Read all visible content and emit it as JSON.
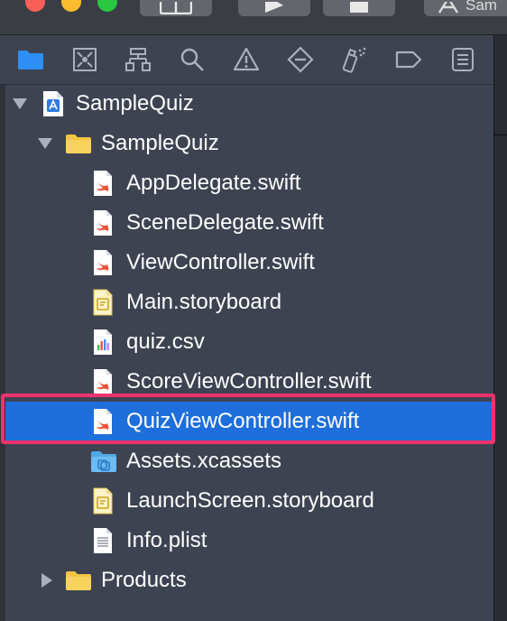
{
  "toolbar": {
    "scheme_label": "Sam"
  },
  "colors": {
    "navigator_bg": "#3e4352",
    "selection": "#1e6edc",
    "highlight_border": "#f0326d",
    "folder": "#f4c542",
    "swift": "#f05138"
  },
  "navigator_icons": [
    "folder-icon",
    "source-control-icon",
    "hierarchy-icon",
    "search-icon",
    "warning-icon",
    "test-diamond-icon",
    "debug-spray-icon",
    "breakpoint-tag-icon",
    "report-icon"
  ],
  "tree": {
    "project": {
      "label": "SampleQuiz",
      "icon": "xcode-project-icon"
    },
    "group": {
      "label": "SampleQuiz",
      "icon": "folder-icon"
    },
    "files": [
      {
        "label": "AppDelegate.swift",
        "icon": "swift-file-icon"
      },
      {
        "label": "SceneDelegate.swift",
        "icon": "swift-file-icon"
      },
      {
        "label": "ViewController.swift",
        "icon": "swift-file-icon"
      },
      {
        "label": "Main.storyboard",
        "icon": "storyboard-file-icon"
      },
      {
        "label": "quiz.csv",
        "icon": "csv-file-icon"
      },
      {
        "label": "ScoreViewController.swift",
        "icon": "swift-file-icon"
      },
      {
        "label": "QuizViewController.swift",
        "icon": "swift-file-icon",
        "selected": true
      },
      {
        "label": "Assets.xcassets",
        "icon": "asset-catalog-icon"
      },
      {
        "label": "LaunchScreen.storyboard",
        "icon": "storyboard-file-icon"
      },
      {
        "label": "Info.plist",
        "icon": "plist-file-icon"
      }
    ],
    "products": {
      "label": "Products",
      "icon": "folder-icon"
    }
  }
}
